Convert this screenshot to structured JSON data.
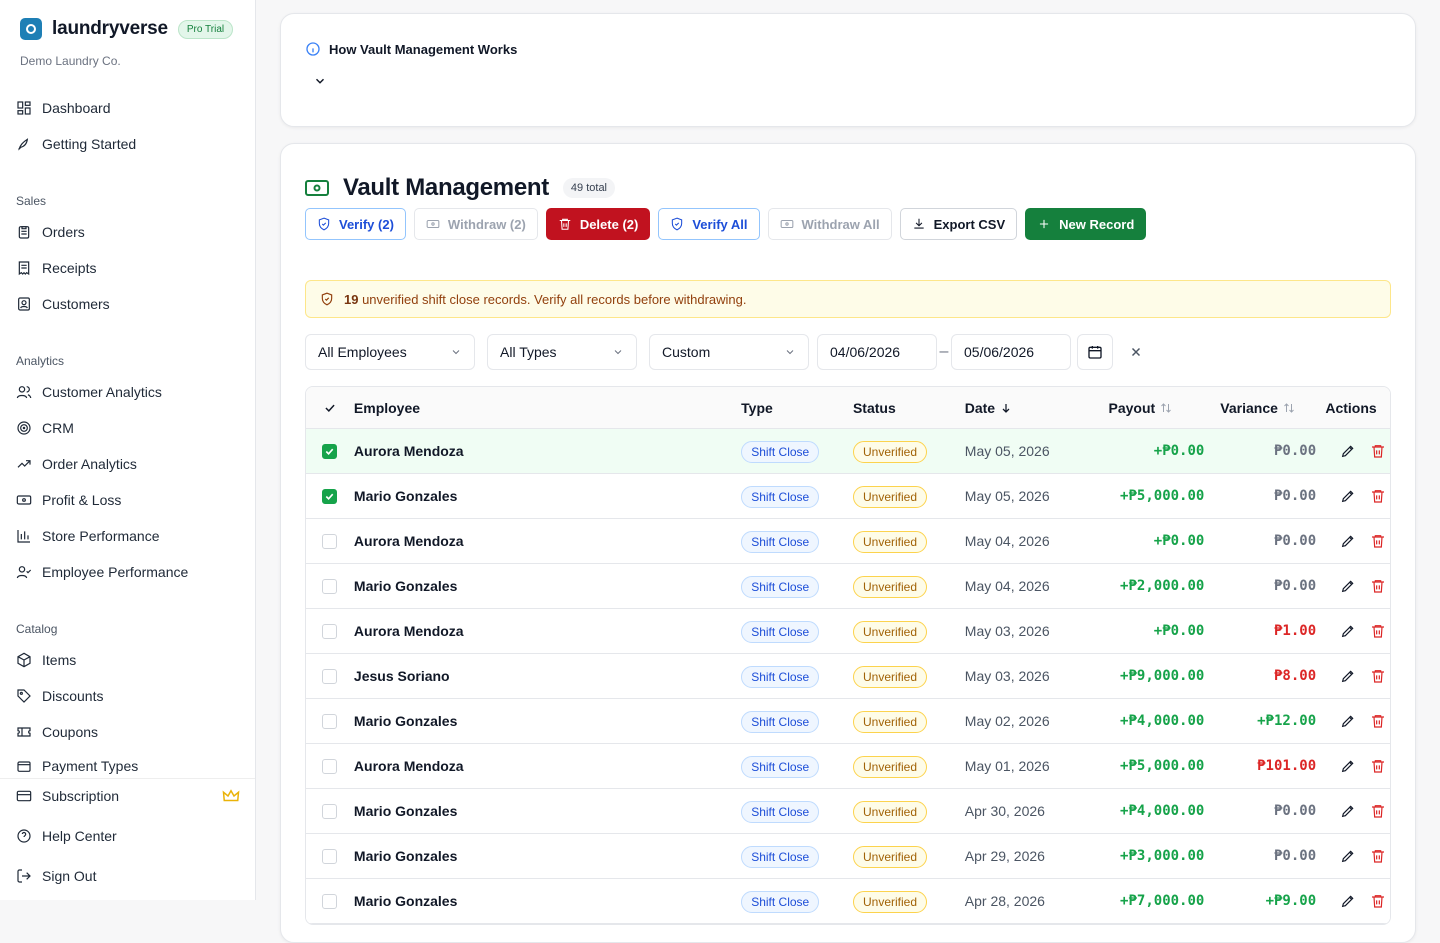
{
  "brand": {
    "name": "laundryverse",
    "badge": "Pro Trial",
    "org": "Demo Laundry Co."
  },
  "nav": {
    "top": [
      {
        "label": "Dashboard",
        "icon": "dashboard-icon"
      },
      {
        "label": "Getting Started",
        "icon": "rocket-icon"
      }
    ],
    "sales_title": "Sales",
    "sales": [
      {
        "label": "Orders",
        "icon": "clipboard-icon"
      },
      {
        "label": "Receipts",
        "icon": "receipt-icon"
      },
      {
        "label": "Customers",
        "icon": "contact-icon"
      }
    ],
    "analytics_title": "Analytics",
    "analytics": [
      {
        "label": "Customer Analytics",
        "icon": "users-icon"
      },
      {
        "label": "CRM",
        "icon": "target-icon"
      },
      {
        "label": "Order Analytics",
        "icon": "trend-icon"
      },
      {
        "label": "Profit & Loss",
        "icon": "banknote-icon"
      },
      {
        "label": "Store Performance",
        "icon": "bar-chart-icon"
      },
      {
        "label": "Employee Performance",
        "icon": "user-check-icon"
      }
    ],
    "catalog_title": "Catalog",
    "catalog": [
      {
        "label": "Items",
        "icon": "package-icon"
      },
      {
        "label": "Discounts",
        "icon": "tag-icon"
      },
      {
        "label": "Coupons",
        "icon": "ticket-icon"
      },
      {
        "label": "Payment Types",
        "icon": "wallet-icon"
      }
    ],
    "bottom": [
      {
        "label": "Subscription",
        "icon": "card-icon"
      },
      {
        "label": "Help Center",
        "icon": "help-icon"
      },
      {
        "label": "Sign Out",
        "icon": "logout-icon"
      }
    ]
  },
  "info": {
    "title": "How Vault Management Works"
  },
  "vault": {
    "title": "Vault Management",
    "count": "49 total",
    "buttons": {
      "verify": "Verify (2)",
      "withdraw": "Withdraw (2)",
      "delete": "Delete (2)",
      "verify_all": "Verify All",
      "withdraw_all": "Withdraw All",
      "export": "Export CSV",
      "new": "New Record"
    },
    "alert": {
      "count": "19",
      "text": " unverified shift close records. Verify all records before withdrawing."
    },
    "filters": {
      "employee": "All Employees",
      "type": "All Types",
      "range": "Custom",
      "from": "04/06/2026",
      "to": "05/06/2026",
      "dash": "–"
    },
    "columns": {
      "employee": "Employee",
      "type": "Type",
      "status": "Status",
      "date": "Date",
      "payout": "Payout",
      "variance": "Variance",
      "actions": "Actions"
    },
    "rows": [
      {
        "name": "Aurora Mendoza",
        "type": "Shift Close",
        "status": "Unverified",
        "date": "May 05, 2026",
        "payout": "+₱0.00",
        "variance": "₱0.00",
        "vcolor": "gr",
        "checked": true
      },
      {
        "name": "Mario Gonzales",
        "type": "Shift Close",
        "status": "Unverified",
        "date": "May 05, 2026",
        "payout": "+₱5,000.00",
        "variance": "₱0.00",
        "vcolor": "gr",
        "checked": true
      },
      {
        "name": "Aurora Mendoza",
        "type": "Shift Close",
        "status": "Unverified",
        "date": "May 04, 2026",
        "payout": "+₱0.00",
        "variance": "₱0.00",
        "vcolor": "gr",
        "checked": false
      },
      {
        "name": "Mario Gonzales",
        "type": "Shift Close",
        "status": "Unverified",
        "date": "May 04, 2026",
        "payout": "+₱2,000.00",
        "variance": "₱0.00",
        "vcolor": "gr",
        "checked": false
      },
      {
        "name": "Aurora Mendoza",
        "type": "Shift Close",
        "status": "Unverified",
        "date": "May 03, 2026",
        "payout": "+₱0.00",
        "variance": "₱1.00",
        "vcolor": "r",
        "checked": false
      },
      {
        "name": "Jesus Soriano",
        "type": "Shift Close",
        "status": "Unverified",
        "date": "May 03, 2026",
        "payout": "+₱9,000.00",
        "variance": "₱8.00",
        "vcolor": "r",
        "checked": false
      },
      {
        "name": "Mario Gonzales",
        "type": "Shift Close",
        "status": "Unverified",
        "date": "May 02, 2026",
        "payout": "+₱4,000.00",
        "variance": "+₱12.00",
        "vcolor": "g",
        "checked": false
      },
      {
        "name": "Aurora Mendoza",
        "type": "Shift Close",
        "status": "Unverified",
        "date": "May 01, 2026",
        "payout": "+₱5,000.00",
        "variance": "₱101.00",
        "vcolor": "r",
        "checked": false
      },
      {
        "name": "Mario Gonzales",
        "type": "Shift Close",
        "status": "Unverified",
        "date": "Apr 30, 2026",
        "payout": "+₱4,000.00",
        "variance": "₱0.00",
        "vcolor": "gr",
        "checked": false
      },
      {
        "name": "Mario Gonzales",
        "type": "Shift Close",
        "status": "Unverified",
        "date": "Apr 29, 2026",
        "payout": "+₱3,000.00",
        "variance": "₱0.00",
        "vcolor": "gr",
        "checked": false
      },
      {
        "name": "Mario Gonzales",
        "type": "Shift Close",
        "status": "Unverified",
        "date": "Apr 28, 2026",
        "payout": "+₱7,000.00",
        "variance": "+₱9.00",
        "vcolor": "g",
        "checked": false
      }
    ]
  }
}
